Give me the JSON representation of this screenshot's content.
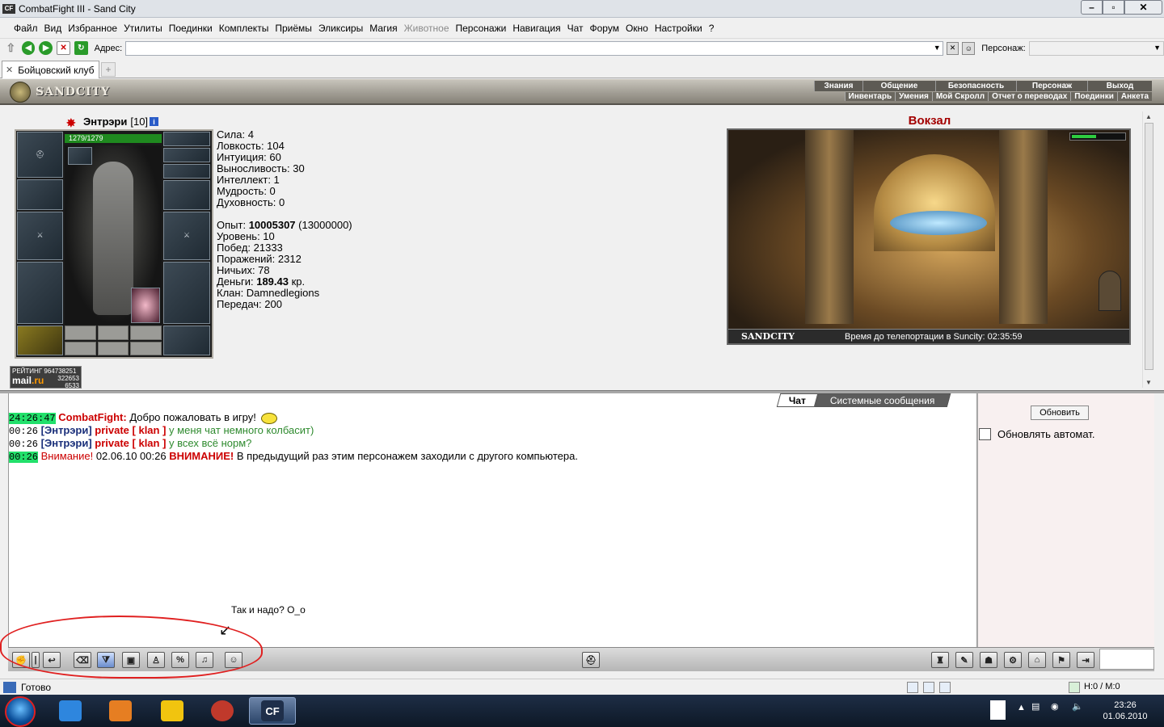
{
  "window": {
    "title": "CombatFight III - Sand City",
    "app_icon": "CF"
  },
  "menu": [
    "Файл",
    "Вид",
    "Избранное",
    "Утилиты",
    "Поединки",
    "Комплекты",
    "Приёмы",
    "Эликсиры",
    "Магия",
    "Животное",
    "Персонажи",
    "Навигация",
    "Чат",
    "Форум",
    "Окно",
    "Настройки",
    "?"
  ],
  "menu_disabled_index": 9,
  "address": {
    "label": "Адрес:",
    "value": "",
    "persona_label": "Персонаж:"
  },
  "tabs": [
    {
      "label": "Бойцовский клуб"
    }
  ],
  "game": {
    "logo": "SANDCITY",
    "nav": [
      "Знания",
      "Общение",
      "Безопасность",
      "Персонаж",
      "Выход"
    ],
    "subnav": [
      "Инвентарь",
      "Умения",
      "Мой Скролл",
      "Отчет о переводах",
      "Поединки",
      "Анкета"
    ]
  },
  "character": {
    "name": "Энтрэри",
    "level": "[10]",
    "hp": "1279/1279",
    "hp_fraction": 1.0,
    "stats": [
      "Сила: 4",
      "Ловкость: 104",
      "Интуиция: 60",
      "Выносливость: 30",
      "Интеллект: 1",
      "Мудрость: 0",
      "Духовность: 0"
    ],
    "exp_label": "Опыт: ",
    "exp_value": "10005307",
    "exp_next": " (13000000)",
    "level_line": "Уровень: 10",
    "wins": "Побед: 21333",
    "losses": "Поражений: 2312",
    "draws": "Ничьих: 78",
    "money_label": "Деньги: ",
    "money_value": "189.43",
    "money_unit": " кр.",
    "clan": "Клан: Damnedlegions",
    "transfers": "Передач: 200"
  },
  "rating": {
    "label": "РЕЙТИНГ",
    "n1": "964738251",
    "n2": "322653",
    "n3": "6533",
    "brand": "mail",
    "brand_suffix": ".ru"
  },
  "location": {
    "title": "Вокзал",
    "brand": "SANDCITY",
    "teleport_text": "Время до телепортации в Suncity: 02:35:59",
    "gauge_fraction": 0.45
  },
  "chat": {
    "tabs": [
      "Чат",
      "Системные сообщения"
    ],
    "lines": [
      {
        "time": "24:26:47",
        "highlight": true,
        "sender": "CombatFight:",
        "text": " Добро пожаловать в игру!"
      },
      {
        "time": "00:26",
        "highlight": false,
        "nick": "[Энтрэри]",
        "private": "private [ klan ]",
        "text": "у меня чат немного колбасит)"
      },
      {
        "time": "00:26",
        "highlight": false,
        "nick": "[Энтрэри]",
        "private": "private [ klan ]",
        "text": "у всех всё норм?"
      },
      {
        "time": "00:26",
        "highlight": true,
        "warn": "Внимание!",
        "date": " 02.06.10 00:26 ",
        "caps": "ВНИМАНИЕ!",
        "text": " В предыдущий раз этим персонажем заходили с другого компьютера."
      }
    ]
  },
  "side": {
    "refresh_label": "Обновить",
    "auto_label": "Обновлять автомат."
  },
  "annotation": "Так и надо? О_о",
  "status": {
    "text": "Готово",
    "hm": "Н:0 / М:0"
  },
  "clock": {
    "time": "23:26",
    "date": "01.06.2010"
  },
  "colors": {
    "accent_red": "#a30000",
    "hp_green": "#1f8a1f",
    "highlight_green": "#22e06b",
    "nick_blue": "#1a2f7a"
  }
}
